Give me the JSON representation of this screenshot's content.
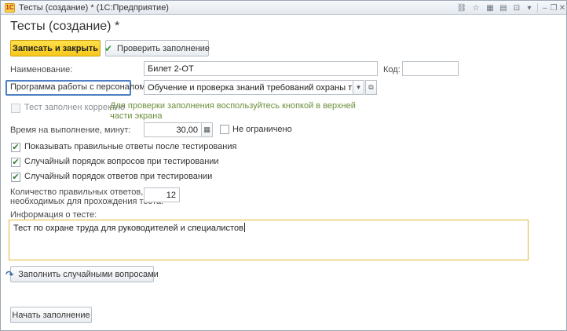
{
  "window": {
    "app_icon_text": "1С",
    "title": "Тесты (создание) * (1С:Предприятие)",
    "controls": [
      {
        "name": "link-icon",
        "glyph": "⛓"
      },
      {
        "name": "favorite-icon",
        "glyph": "☆"
      },
      {
        "name": "calendar-icon",
        "glyph": "▦"
      },
      {
        "name": "calculator-icon",
        "glyph": "▤"
      },
      {
        "name": "history-icon",
        "glyph": "⊡"
      },
      {
        "name": "menu-icon",
        "glyph": "▾"
      },
      {
        "name": "minimize-icon",
        "glyph": "‒"
      },
      {
        "name": "restore-icon",
        "glyph": "❐"
      },
      {
        "name": "close-icon",
        "glyph": "✕"
      }
    ]
  },
  "form": {
    "title": "Тесты (создание) *",
    "toolbar": {
      "save_close": "Записать и закрыть",
      "check_fill": "Проверить заполнение",
      "check_icon": "✔"
    },
    "name_label": "Наименование:",
    "name_value": "Билет 2-ОТ",
    "code_label": "Код:",
    "code_value": "",
    "program_label": "Программа работы с персоналом:",
    "program_value": "Обучение и проверка знаний требований охраны труда рукс",
    "dropdown_glyph": "▾",
    "open_glyph": "⧉",
    "test_correct_label": "Тест заполнен корректно",
    "test_correct_hint": "Для проверки заполнения воспользуйтесь кнопкой в верхней части экрана",
    "time_label": "Время на выполнение, минут:",
    "time_value": "30,00",
    "calc_glyph": "▦",
    "unlimited_label": "Не ограничено",
    "checkboxes": {
      "show_answers": "Показывать правильные ответы после тестирования",
      "random_questions": "Случайный порядок вопросов при тестировании",
      "random_answers": "Случайный порядок ответов при тестировании"
    },
    "check_glyph": "✔",
    "correct_count_label_1": "Количество правильных ответов,",
    "correct_count_label_2": "необходимых для прохождения теста:",
    "correct_count_value": "12",
    "info_label": "Информация о тесте:",
    "info_value": "Тест по охране труда для руководителей и специалистов",
    "fill_random_button": "Заполнить случайными вопросами",
    "fill_random_icon": "↷",
    "start_fill_button": "Начать заполнение"
  }
}
